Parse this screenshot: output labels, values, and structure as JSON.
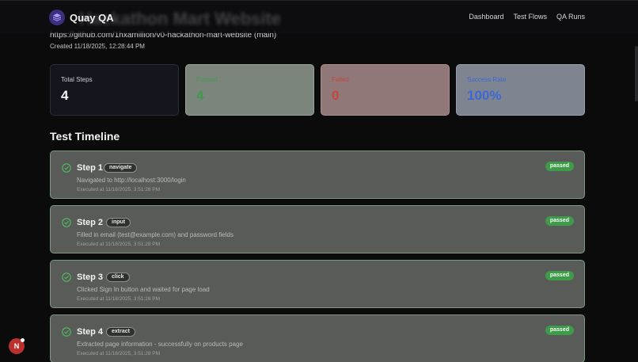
{
  "header": {
    "brand": "Quay QA",
    "ghost_title": "Hackathon Mart Website",
    "nav": [
      "Dashboard",
      "Test Flows",
      "QA Runs"
    ]
  },
  "run": {
    "repo": "https://github.com/1hxamillion/v0-hackathon-mart-website (main)",
    "created": "Created 11/18/2025, 12:28:44 PM"
  },
  "stats": {
    "total_label": "Total Steps",
    "total_value": "4",
    "passed_label": "Passed",
    "passed_value": "4",
    "failed_label": "Failed",
    "failed_value": "0",
    "rate_label": "Success Rate",
    "rate_value": "100%"
  },
  "timeline": {
    "title": "Test Timeline",
    "steps": [
      {
        "title": "Step 1",
        "action": "navigate",
        "desc": "Navigated to http://localhost:3000/login",
        "executed": "Executed at 11/18/2025, 3:51:28 PM",
        "status": "passed"
      },
      {
        "title": "Step 2",
        "action": "input",
        "desc": "Filled in email (test@example.com) and password fields",
        "executed": "Executed at 11/18/2025, 3:51:28 PM",
        "status": "passed"
      },
      {
        "title": "Step 3",
        "action": "click",
        "desc": "Clicked Sign In button and waited for page load",
        "executed": "Executed at 11/18/2025, 3:51:28 PM",
        "status": "passed"
      },
      {
        "title": "Step 4",
        "action": "extract",
        "desc": "Extracted page information - successfully on products page",
        "executed": "Executed at 11/18/2025, 3:51:28 PM",
        "status": "passed"
      }
    ]
  },
  "fab": {
    "letter": "N"
  },
  "icons": {
    "brand": "layers-icon",
    "step": "check-circle-icon"
  },
  "colors": {
    "passed": "#3f9a4a",
    "failed": "#c7443f",
    "rate": "#3d66d6"
  }
}
